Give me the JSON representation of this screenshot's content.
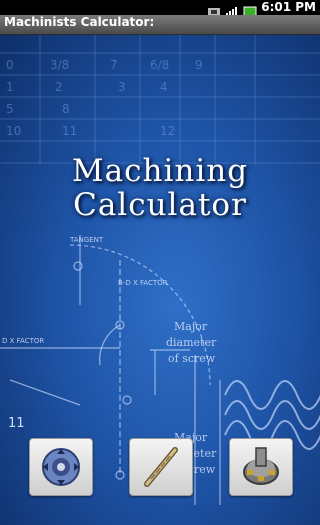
{
  "status_bar": {
    "time": "6:01 PM"
  },
  "app": {
    "title": "Machinists Calculator:"
  },
  "headline": {
    "line1": "Machining",
    "line2": "Calculator"
  },
  "background": {
    "table_numbers": [
      "0",
      "3/8",
      "7",
      "6/8",
      "9",
      "1",
      "2",
      "3",
      "4",
      "5",
      "8",
      "10",
      "11",
      "12"
    ],
    "labels": {
      "tangent": "TANGENT",
      "b_d_factor": "B-D X FACTOR",
      "d_factor": "D X FACTOR",
      "major": "Major",
      "diameter": "diameter",
      "of_screw": "of screw",
      "corner_num": "11"
    }
  },
  "buttons": [
    {
      "icon": "milling-cutter-icon"
    },
    {
      "icon": "drill-bit-icon"
    },
    {
      "icon": "face-mill-icon"
    }
  ],
  "colors": {
    "accent": "#2f6fc7",
    "title_bar": "#5a5a5a"
  }
}
